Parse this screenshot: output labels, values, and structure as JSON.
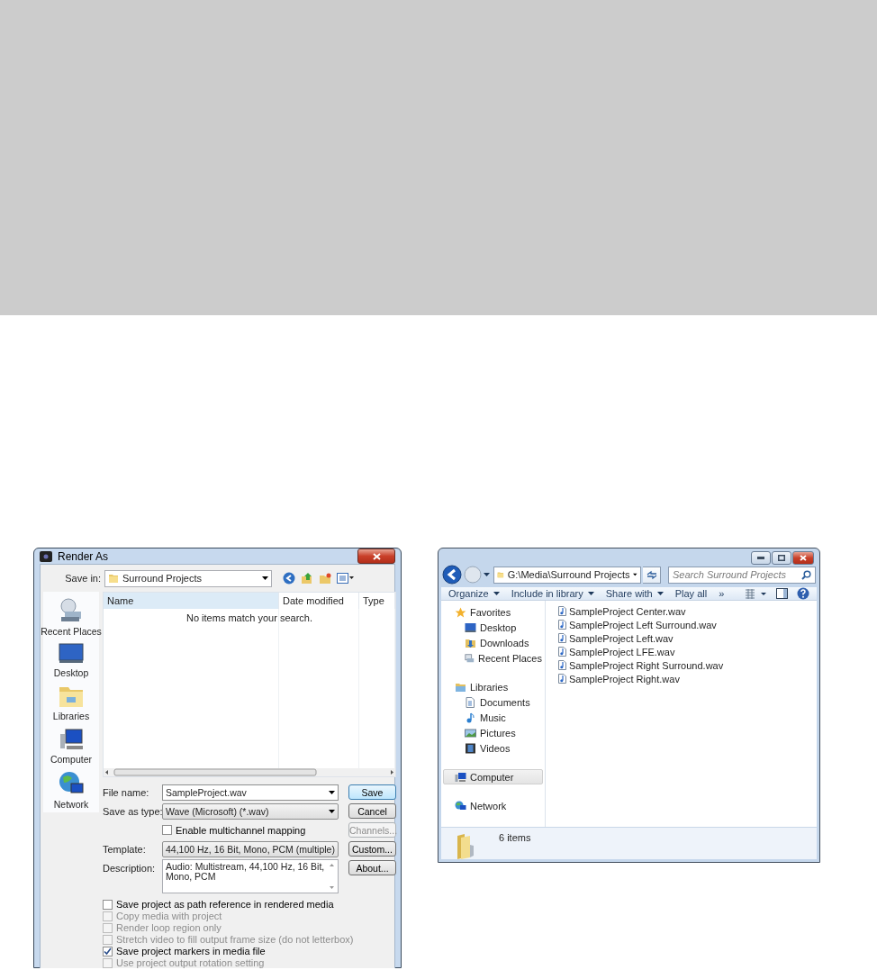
{
  "render_dialog": {
    "title": "Render As",
    "save_in": {
      "label": "Save in:",
      "value": "Surround Projects"
    },
    "places": [
      {
        "label": "Recent Places"
      },
      {
        "label": "Desktop"
      },
      {
        "label": "Libraries"
      },
      {
        "label": "Computer"
      },
      {
        "label": "Network"
      }
    ],
    "file_list": {
      "columns": [
        "Name",
        "Date modified",
        "Type"
      ],
      "empty_message": "No items match your search."
    },
    "fields": [
      {
        "label": "File name:",
        "value": "SampleProject.wav",
        "kind": "combo"
      },
      {
        "label": "Save as type:",
        "value": "Wave (Microsoft) (*.wav)",
        "kind": "dropdown"
      },
      {
        "label": "Enable multichannel mapping",
        "checked": false,
        "kind": "checkbox"
      },
      {
        "label": "Template:",
        "value": "44,100 Hz, 16 Bit, Mono, PCM (multiple)",
        "kind": "dropdown"
      },
      {
        "label": "Description:",
        "value": "Audio: Multistream, 44,100 Hz, 16 Bit, Mono, PCM",
        "kind": "textarea"
      }
    ],
    "buttons": [
      {
        "label": "Save",
        "default": true,
        "disabled": false
      },
      {
        "label": "Cancel",
        "default": false,
        "disabled": false
      },
      {
        "label": "Channels...",
        "default": false,
        "disabled": true
      },
      {
        "label": "Custom...",
        "default": false,
        "disabled": false
      },
      {
        "label": "About...",
        "default": false,
        "disabled": false
      }
    ],
    "options": [
      {
        "label": "Save project as path reference in rendered media",
        "checked": false,
        "disabled": false
      },
      {
        "label": "Copy media with project",
        "checked": false,
        "disabled": true
      },
      {
        "label": "Render loop region only",
        "checked": false,
        "disabled": true
      },
      {
        "label": "Stretch video to fill output frame size (do not letterbox)",
        "checked": false,
        "disabled": true
      },
      {
        "label": "Save project markers in media file",
        "checked": true,
        "disabled": false
      },
      {
        "label": "Use project output rotation setting",
        "checked": false,
        "disabled": true
      }
    ]
  },
  "explorer": {
    "address": "G:\\Media\\Surround Projects",
    "search": {
      "placeholder": "Search Surround Projects"
    },
    "toolbar": [
      {
        "label": "Organize",
        "dropdown": true
      },
      {
        "label": "Include in library",
        "dropdown": true
      },
      {
        "label": "Share with",
        "dropdown": true
      },
      {
        "label": "Play all",
        "dropdown": false
      },
      {
        "label": "»",
        "dropdown": false
      }
    ],
    "nav": [
      {
        "label": "Favorites",
        "selected": false,
        "children": [
          {
            "label": "Desktop",
            "selected": false
          },
          {
            "label": "Downloads",
            "selected": false
          },
          {
            "label": "Recent Places",
            "selected": false
          }
        ]
      },
      {
        "label": "Libraries",
        "selected": false,
        "children": [
          {
            "label": "Documents",
            "selected": false
          },
          {
            "label": "Music",
            "selected": false
          },
          {
            "label": "Pictures",
            "selected": false
          },
          {
            "label": "Videos",
            "selected": false
          }
        ]
      },
      {
        "label": "Computer",
        "selected": true
      },
      {
        "label": "Network",
        "selected": false
      }
    ],
    "files": [
      "SampleProject Center.wav",
      "SampleProject Left Surround.wav",
      "SampleProject Left.wav",
      "SampleProject LFE.wav",
      "SampleProject Right Surround.wav",
      "SampleProject Right.wav"
    ],
    "status": "6 items"
  }
}
